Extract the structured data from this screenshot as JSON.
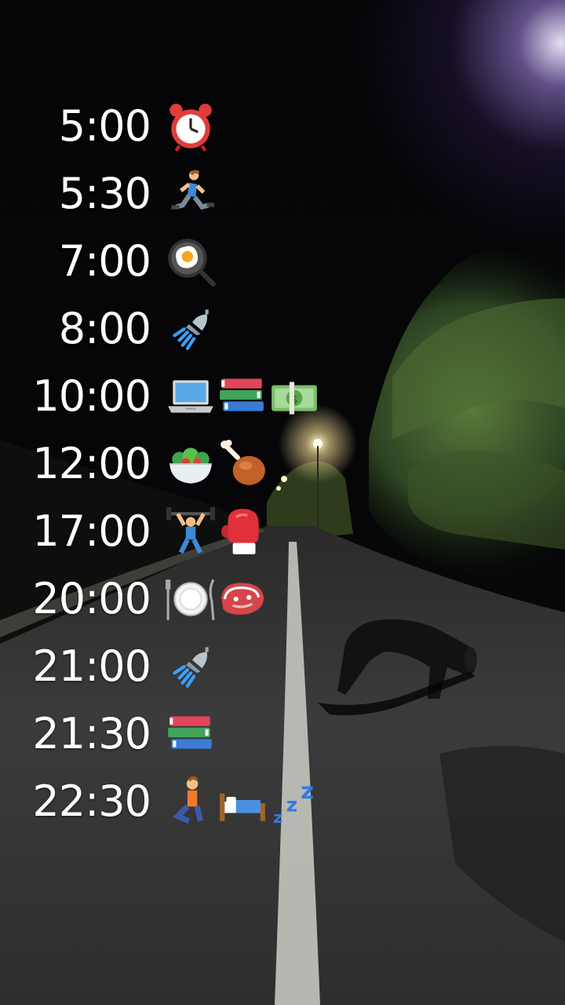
{
  "schedule": [
    {
      "time": "5:00",
      "icons": [
        "alarm-clock-icon"
      ]
    },
    {
      "time": "5:30",
      "icons": [
        "runner-icon"
      ]
    },
    {
      "time": "7:00",
      "icons": [
        "frying-pan-egg-icon"
      ]
    },
    {
      "time": "8:00",
      "icons": [
        "shower-icon"
      ]
    },
    {
      "time": "10:00",
      "icons": [
        "laptop-icon",
        "books-icon",
        "money-icon"
      ]
    },
    {
      "time": "12:00",
      "icons": [
        "salad-icon",
        "chicken-leg-icon"
      ]
    },
    {
      "time": "17:00",
      "icons": [
        "weightlifter-icon",
        "boxing-glove-icon"
      ]
    },
    {
      "time": "20:00",
      "icons": [
        "plate-cutlery-icon",
        "steak-icon"
      ]
    },
    {
      "time": "21:00",
      "icons": [
        "shower-icon"
      ]
    },
    {
      "time": "21:30",
      "icons": [
        "books-icon"
      ]
    },
    {
      "time": "22:30",
      "icons": [
        "kneeling-person-icon",
        "bed-icon",
        "zzz-icon"
      ]
    }
  ]
}
